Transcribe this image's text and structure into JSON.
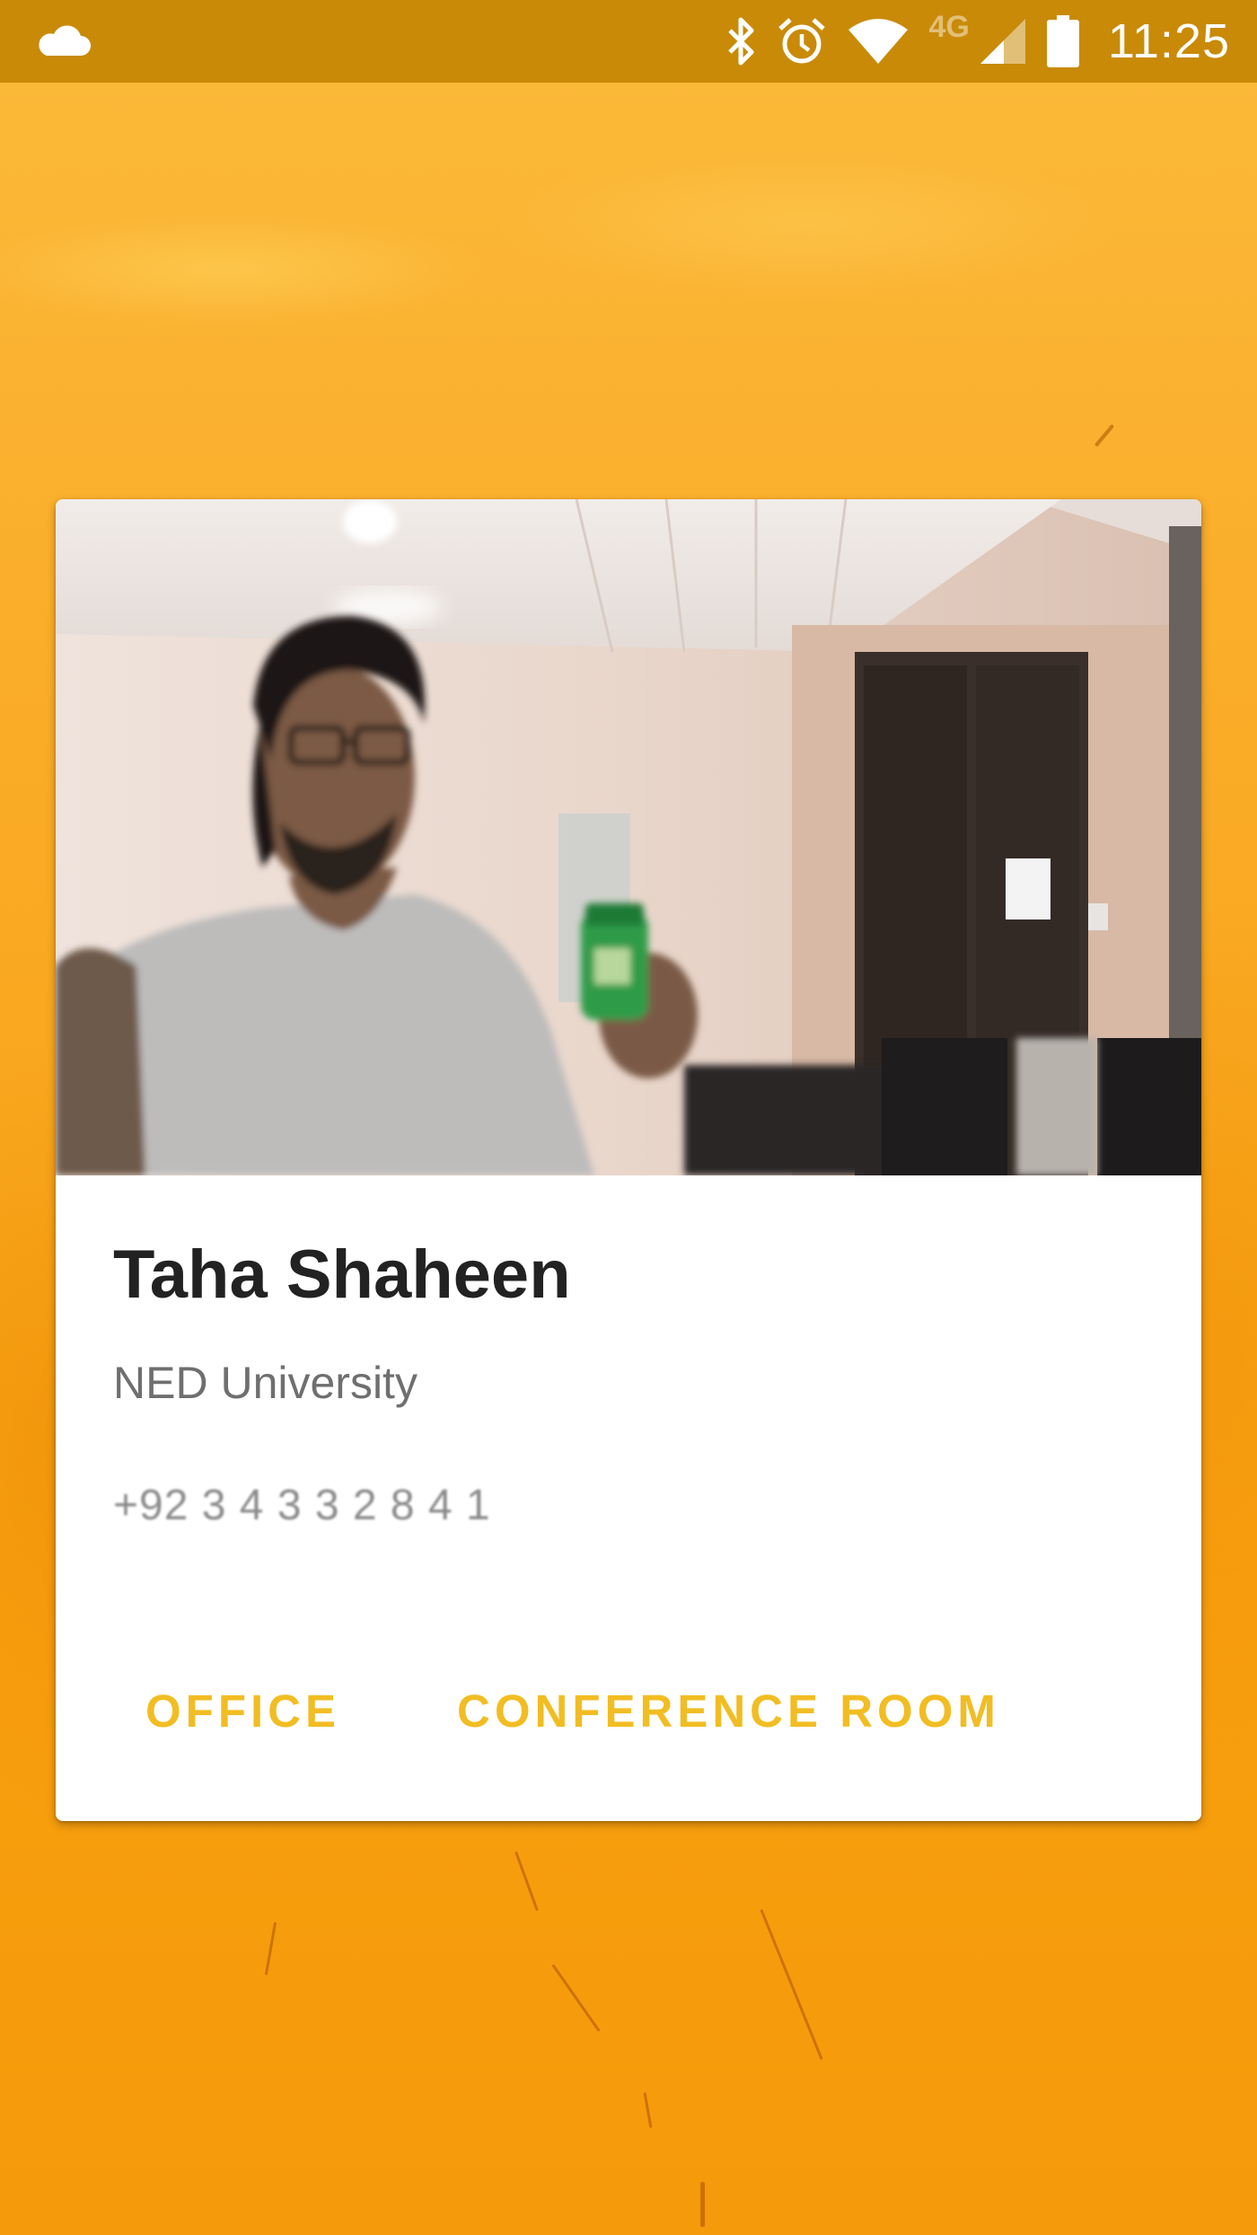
{
  "status_bar": {
    "time": "11:25",
    "network_type": "4G",
    "icons": [
      "cloud-icon",
      "bluetooth-icon",
      "alarm-icon",
      "wifi-icon",
      "signal-icon",
      "battery-icon"
    ]
  },
  "card": {
    "photo": "person-photo",
    "name": "Taha Shaheen",
    "organization": "NED University",
    "phone": "+92 3 4 3 3 2 8 4 1",
    "actions": [
      {
        "label": "OFFICE"
      },
      {
        "label": "CONFERENCE ROOM"
      }
    ]
  },
  "colors": {
    "status_bar": "#c98a08",
    "accent": "#f2bd23",
    "wallpaper": "#f9a820"
  }
}
